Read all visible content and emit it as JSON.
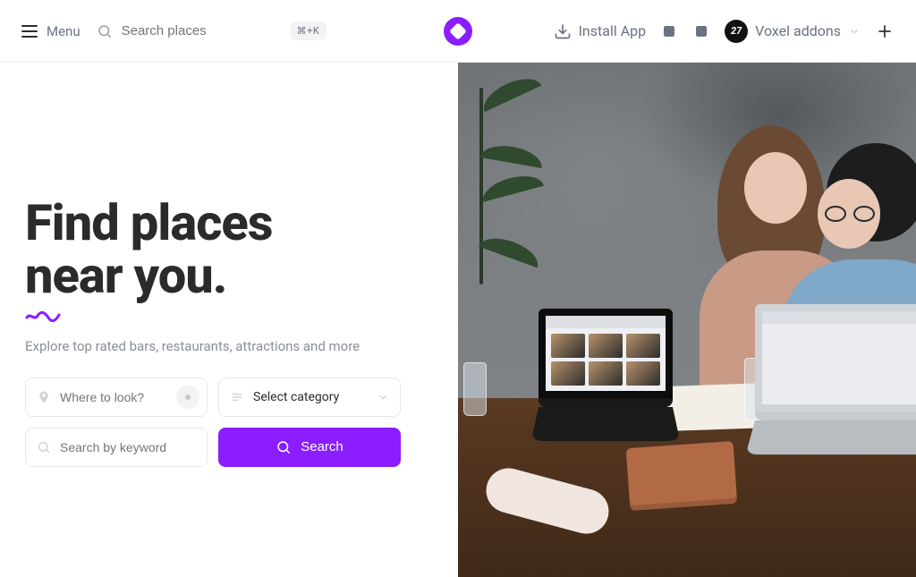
{
  "header": {
    "menu_label": "Menu",
    "search_placeholder": "Search places",
    "shortcut": "⌘+K",
    "install_label": "Install App",
    "user_name": "Voxel addons",
    "avatar_text": "27"
  },
  "hero": {
    "title_line1": "Find places",
    "title_line2": "near you.",
    "subtitle": "Explore top rated bars, restaurants, attractions and more"
  },
  "form": {
    "location_placeholder": "Where to look?",
    "category_label": "Select category",
    "keyword_placeholder": "Search by keyword",
    "search_button": "Search"
  },
  "colors": {
    "accent": "#8b1dff"
  }
}
